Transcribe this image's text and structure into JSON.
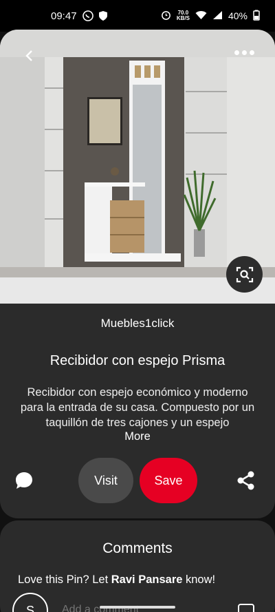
{
  "status_bar": {
    "time": "09:47",
    "net_speed_value": "70.0",
    "net_speed_unit": "KB/S",
    "battery": "40%"
  },
  "pin": {
    "author": "Muebles1click",
    "title": "Recibidor con espejo Prisma",
    "description": "Recibidor con espejo económico y moderno para la entrada de su casa. Compuesto por un taquillón de tres cajones y un espejo",
    "more_label": "More",
    "visit_label": "Visit",
    "save_label": "Save"
  },
  "comments": {
    "title": "Comments",
    "prompt_prefix": "Love this Pin? Let ",
    "prompt_user": "Ravi Pansare",
    "prompt_suffix": " know!",
    "avatar_letter": "S",
    "input_placeholder": "Add a comment"
  },
  "colors": {
    "save": "#e60023",
    "visit": "#4a4a4a",
    "card": "#2b2b2b"
  }
}
